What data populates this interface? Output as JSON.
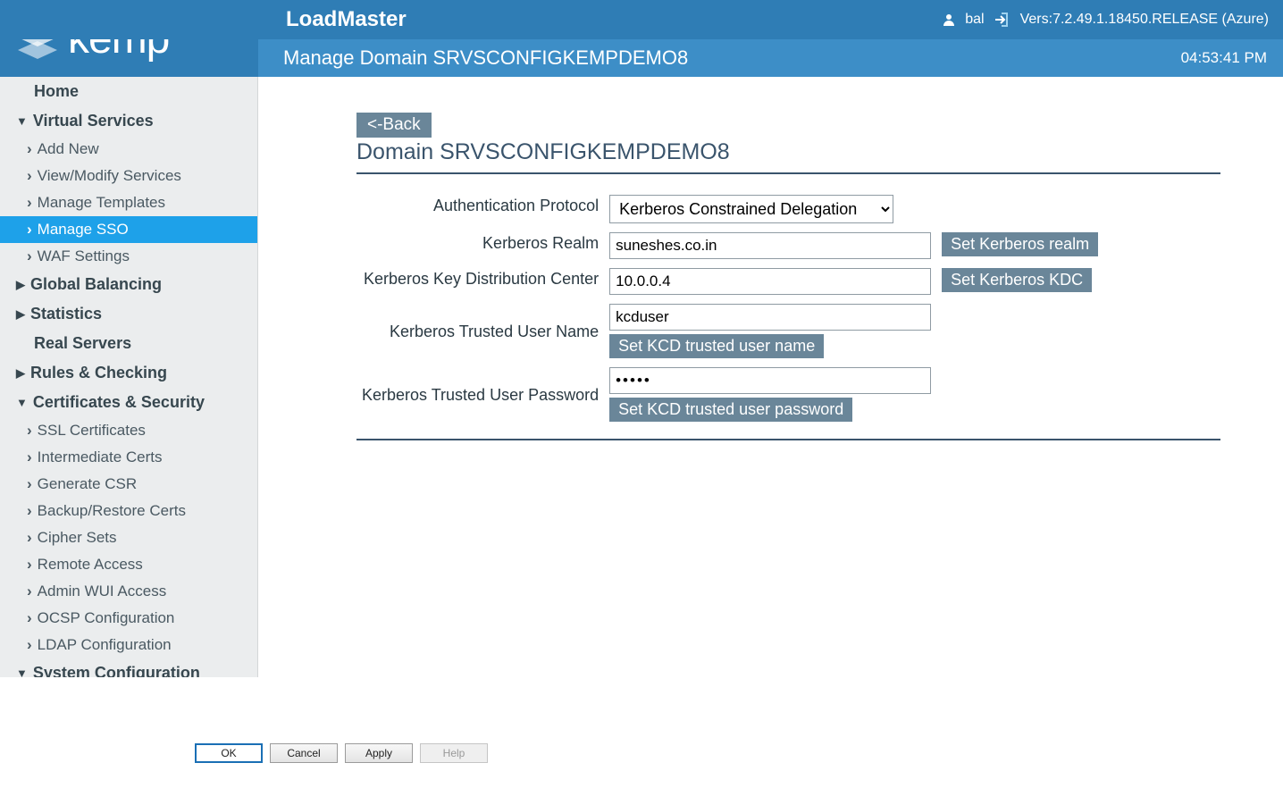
{
  "header": {
    "app_title": "LoadMaster",
    "username": "bal",
    "version": "Vers:7.2.49.1.18450.RELEASE (Azure)",
    "subtitle": "Manage Domain SRVSCONFIGKEMPDEMO8",
    "time": "04:53:41 PM",
    "logo_text": "kemp"
  },
  "sidebar": {
    "items": [
      {
        "label": "Home",
        "type": "top",
        "nocaret": true
      },
      {
        "label": "Virtual Services",
        "type": "top",
        "caret": "down"
      },
      {
        "label": "Add New",
        "type": "sub"
      },
      {
        "label": "View/Modify Services",
        "type": "sub"
      },
      {
        "label": "Manage Templates",
        "type": "sub"
      },
      {
        "label": "Manage SSO",
        "type": "sub",
        "active": true
      },
      {
        "label": "WAF Settings",
        "type": "sub"
      },
      {
        "label": "Global Balancing",
        "type": "top",
        "caret": "right"
      },
      {
        "label": "Statistics",
        "type": "top",
        "caret": "right"
      },
      {
        "label": "Real Servers",
        "type": "top",
        "nocaret": true
      },
      {
        "label": "Rules & Checking",
        "type": "top",
        "caret": "right"
      },
      {
        "label": "Certificates & Security",
        "type": "top",
        "caret": "down"
      },
      {
        "label": "SSL Certificates",
        "type": "sub"
      },
      {
        "label": "Intermediate Certs",
        "type": "sub"
      },
      {
        "label": "Generate CSR",
        "type": "sub"
      },
      {
        "label": "Backup/Restore Certs",
        "type": "sub"
      },
      {
        "label": "Cipher Sets",
        "type": "sub"
      },
      {
        "label": "Remote Access",
        "type": "sub"
      },
      {
        "label": "Admin WUI Access",
        "type": "sub"
      },
      {
        "label": "OCSP Configuration",
        "type": "sub"
      },
      {
        "label": "LDAP Configuration",
        "type": "sub"
      },
      {
        "label": "System Configuration",
        "type": "top",
        "caret": "down"
      }
    ]
  },
  "main": {
    "back_label": "<-Back",
    "heading": "Domain SRVSCONFIGKEMPDEMO8",
    "fields": {
      "auth_protocol": {
        "label": "Authentication Protocol",
        "value": "Kerberos Constrained Delegation"
      },
      "realm": {
        "label": "Kerberos Realm",
        "value": "suneshes.co.in",
        "button": "Set Kerberos realm"
      },
      "kdc": {
        "label": "Kerberos Key Distribution Center",
        "value": "10.0.0.4",
        "button": "Set Kerberos KDC"
      },
      "trusted_user": {
        "label": "Kerberos Trusted User Name",
        "value": "kcduser",
        "button": "Set KCD trusted user name"
      },
      "trusted_pass": {
        "label": "Kerberos Trusted User Password",
        "value": "•••••",
        "button": "Set KCD trusted user password"
      }
    }
  },
  "dialog": {
    "ok": "OK",
    "cancel": "Cancel",
    "apply": "Apply",
    "help": "Help"
  }
}
